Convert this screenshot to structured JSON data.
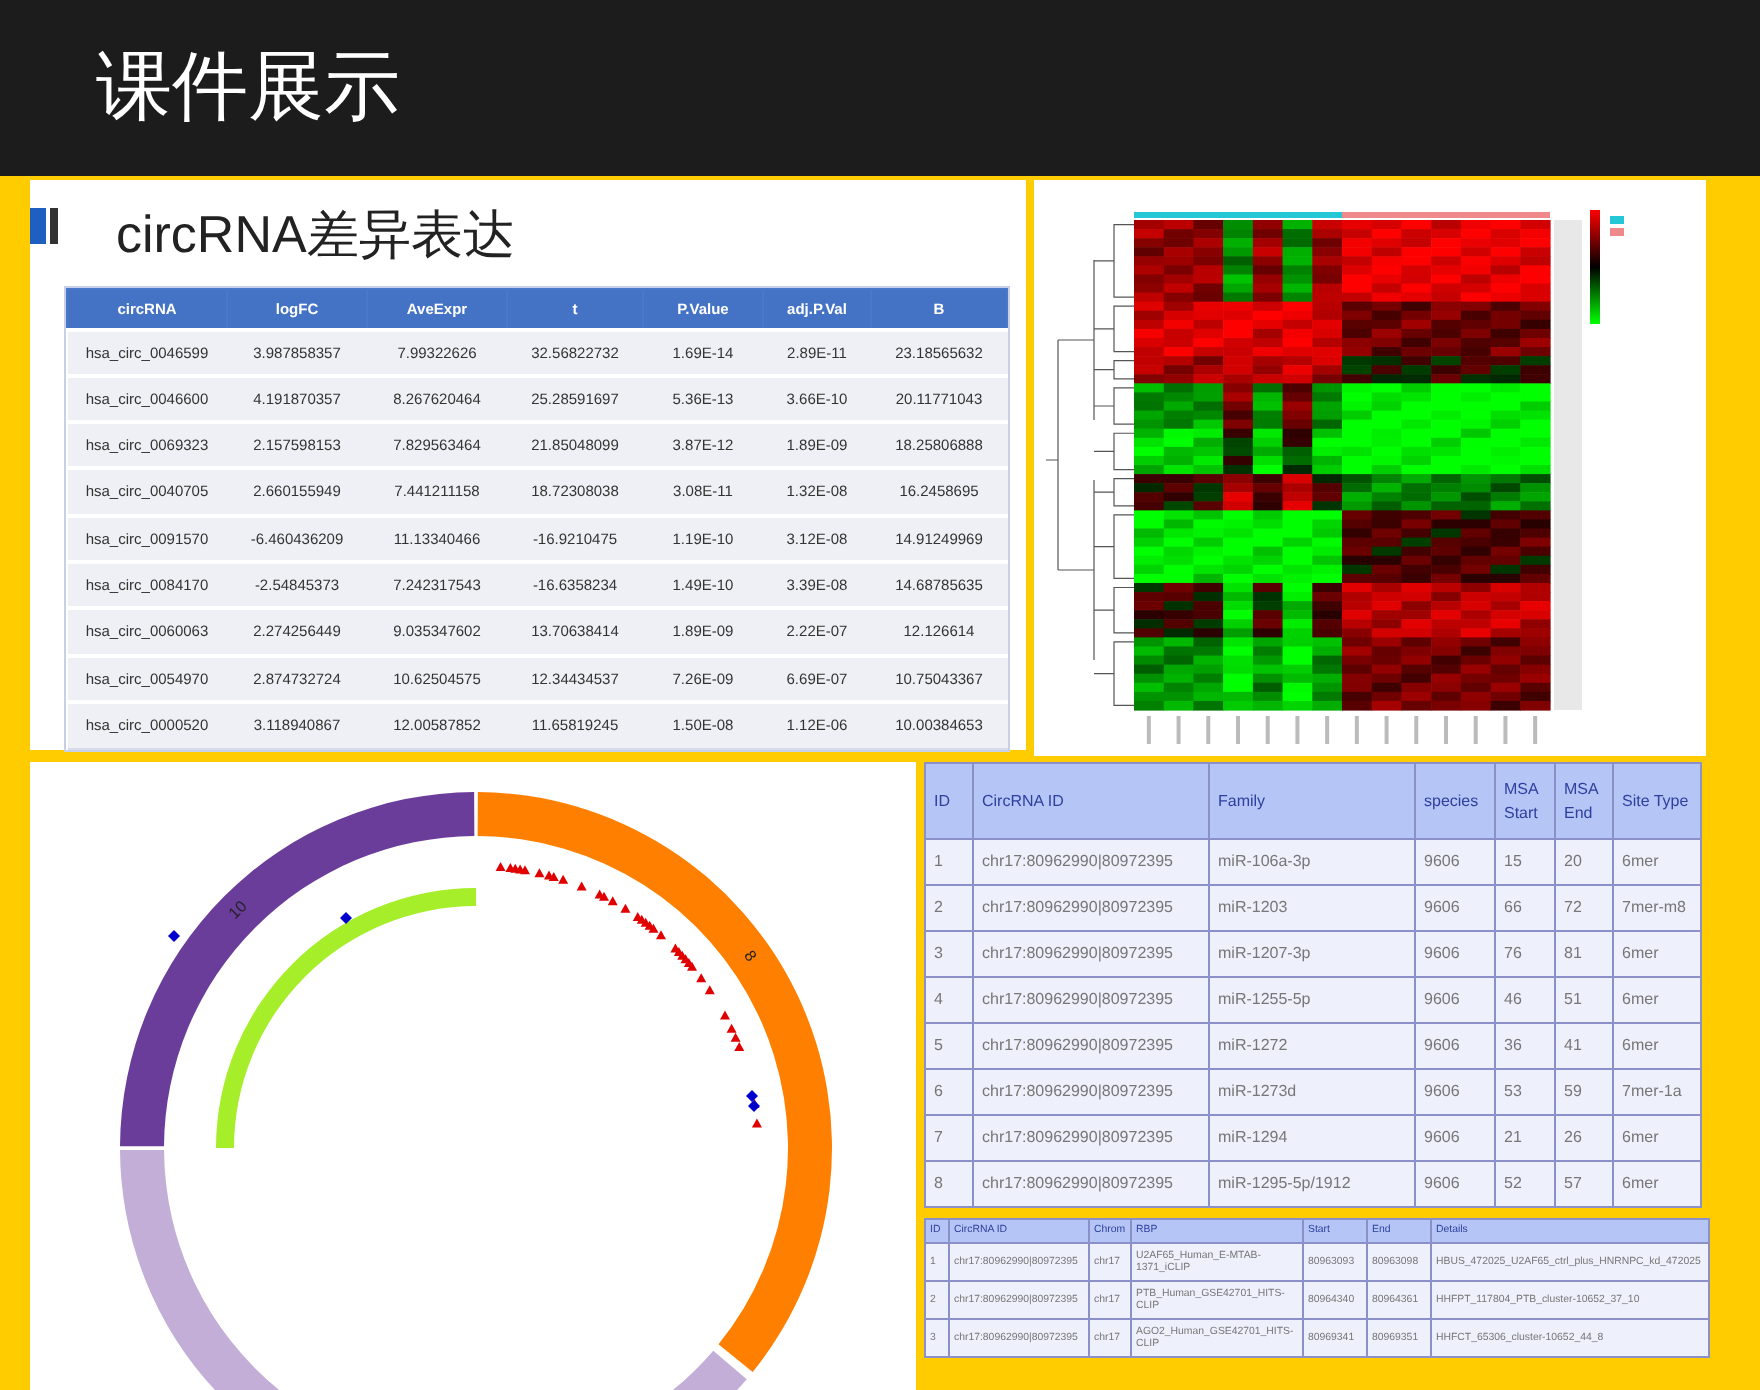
{
  "header": {
    "title": "课件展示"
  },
  "expression_panel": {
    "title": "circRNA差异表达",
    "columns": [
      "circRNA",
      "logFC",
      "AveExpr",
      "t",
      "P.Value",
      "adj.P.Val",
      "B"
    ],
    "rows": [
      [
        "hsa_circ_0046599",
        "3.987858357",
        "7.99322626",
        "32.56822732",
        "1.69E-14",
        "2.89E-11",
        "23.18565632"
      ],
      [
        "hsa_circ_0046600",
        "4.191870357",
        "8.267620464",
        "25.28591697",
        "5.36E-13",
        "3.66E-10",
        "20.11771043"
      ],
      [
        "hsa_circ_0069323",
        "2.157598153",
        "7.829563464",
        "21.85048099",
        "3.87E-12",
        "1.89E-09",
        "18.25806888"
      ],
      [
        "hsa_circ_0040705",
        "2.660155949",
        "7.441211158",
        "18.72308038",
        "3.08E-11",
        "1.32E-08",
        "16.2458695"
      ],
      [
        "hsa_circ_0091570",
        "-6.460436209",
        "11.13340466",
        "-16.9210475",
        "1.19E-10",
        "3.12E-08",
        "14.91249969"
      ],
      [
        "hsa_circ_0084170",
        "-2.54845373",
        "7.242317543",
        "-16.6358234",
        "1.49E-10",
        "3.39E-08",
        "14.68785635"
      ],
      [
        "hsa_circ_0060063",
        "2.274256449",
        "9.035347602",
        "13.70638414",
        "1.89E-09",
        "2.22E-07",
        "12.126614"
      ],
      [
        "hsa_circ_0054970",
        "2.874732724",
        "10.62504575",
        "12.34434537",
        "7.26E-09",
        "6.69E-07",
        "10.75043367"
      ],
      [
        "hsa_circ_0000520",
        "3.118940867",
        "12.00587852",
        "11.65819245",
        "1.50E-08",
        "1.12E-06",
        "10.00384653"
      ]
    ]
  },
  "circos": {
    "labels": [
      "10",
      "8"
    ]
  },
  "mirna_table": {
    "columns": [
      "ID",
      "CircRNA ID",
      "Family",
      "species",
      "MSA Start",
      "MSA End",
      "Site Type"
    ],
    "rows": [
      [
        "1",
        "chr17:80962990|80972395",
        "miR-106a-3p",
        "9606",
        "15",
        "20",
        "6mer"
      ],
      [
        "2",
        "chr17:80962990|80972395",
        "miR-1203",
        "9606",
        "66",
        "72",
        "7mer-m8"
      ],
      [
        "3",
        "chr17:80962990|80972395",
        "miR-1207-3p",
        "9606",
        "76",
        "81",
        "6mer"
      ],
      [
        "4",
        "chr17:80962990|80972395",
        "miR-1255-5p",
        "9606",
        "46",
        "51",
        "6mer"
      ],
      [
        "5",
        "chr17:80962990|80972395",
        "miR-1272",
        "9606",
        "36",
        "41",
        "6mer"
      ],
      [
        "6",
        "chr17:80962990|80972395",
        "miR-1273d",
        "9606",
        "53",
        "59",
        "7mer-1a"
      ],
      [
        "7",
        "chr17:80962990|80972395",
        "miR-1294",
        "9606",
        "21",
        "26",
        "6mer"
      ],
      [
        "8",
        "chr17:80962990|80972395",
        "miR-1295-5p/1912",
        "9606",
        "52",
        "57",
        "6mer"
      ]
    ]
  },
  "rbp_table": {
    "columns": [
      "ID",
      "CircRNA ID",
      "Chrom",
      "RBP",
      "Start",
      "End",
      "Details"
    ],
    "rows": [
      [
        "1",
        "chr17:80962990|80972395",
        "chr17",
        "U2AF65_Human_E-MTAB-1371_iCLIP",
        "80963093",
        "80963098",
        "HBUS_472025_U2AF65_ctrl_plus_HNRNPC_kd_472025"
      ],
      [
        "2",
        "chr17:80962990|80972395",
        "chr17",
        "PTB_Human_GSE42701_HITS-CLIP",
        "80964340",
        "80964361",
        "HHFPT_117804_PTB_cluster-10652_37_10"
      ],
      [
        "3",
        "chr17:80962990|80972395",
        "chr17",
        "AGO2_Human_GSE42701_HITS-CLIP",
        "80969341",
        "80969351",
        "HHFCT_65306_cluster-10652_44_8"
      ]
    ]
  }
}
